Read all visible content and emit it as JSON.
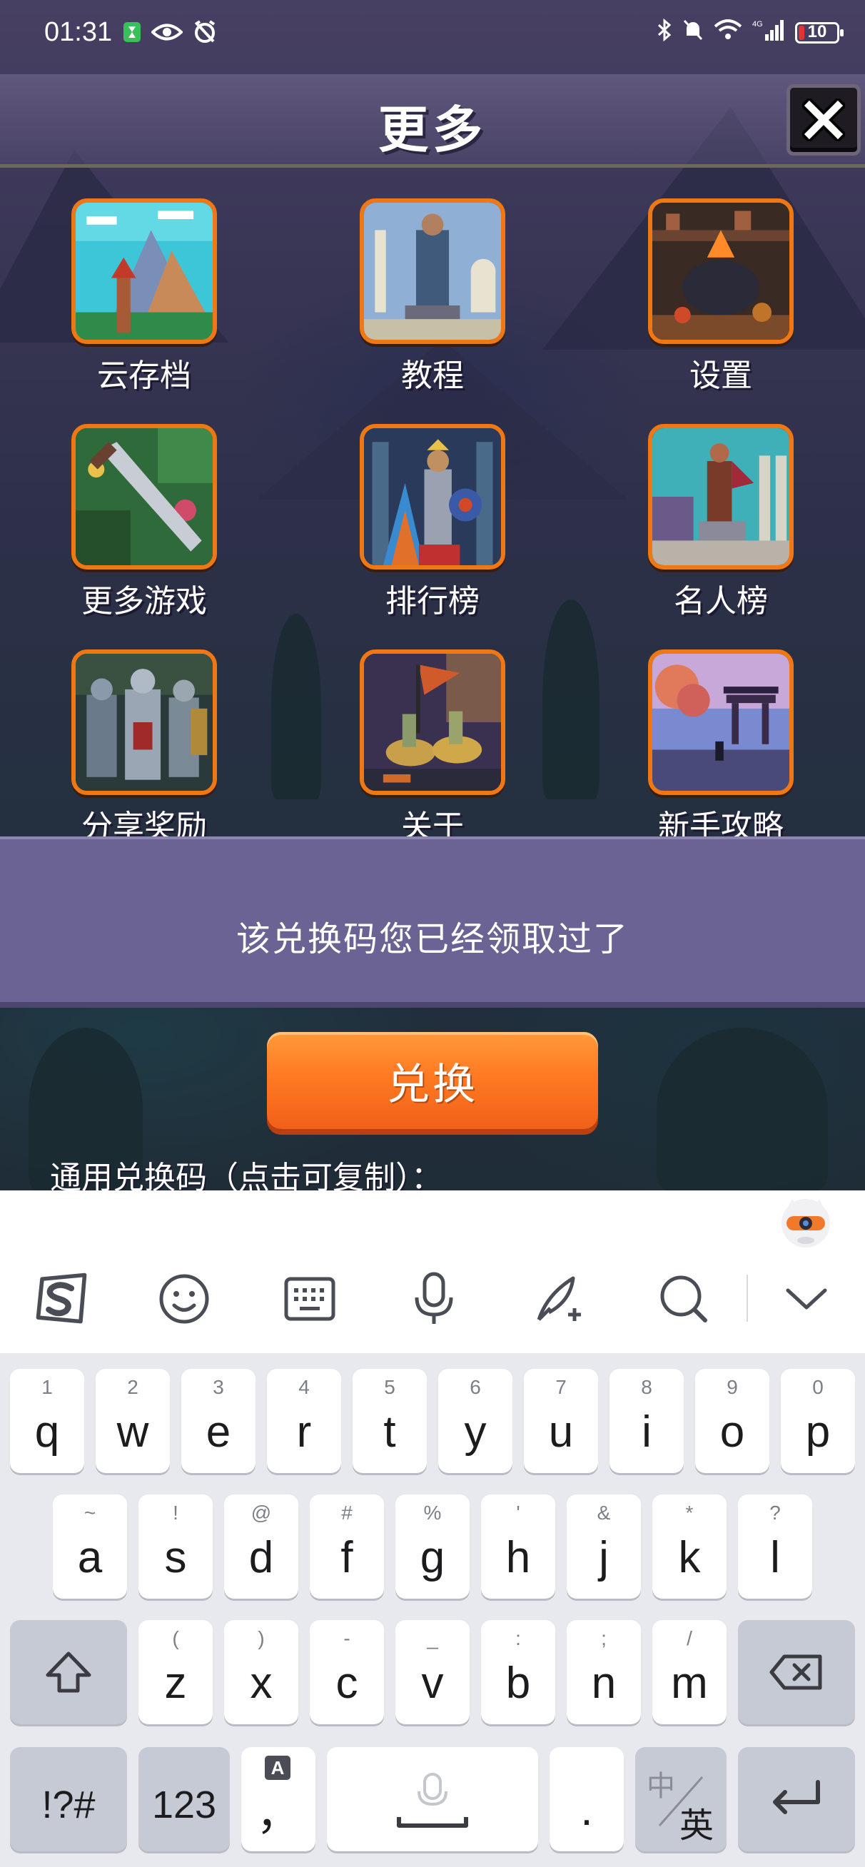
{
  "status_bar": {
    "time": "01:31",
    "battery_level": 10,
    "network": "4G"
  },
  "header": {
    "title": "更多",
    "close_icon": "close-x-icon"
  },
  "menu_items": [
    {
      "label": "云存档",
      "art": "mountain-tower"
    },
    {
      "label": "教程",
      "art": "statue"
    },
    {
      "label": "设置",
      "art": "cauldron"
    },
    {
      "label": "更多游戏",
      "art": "sword"
    },
    {
      "label": "排行榜",
      "art": "king"
    },
    {
      "label": "名人榜",
      "art": "warrior-statue"
    },
    {
      "label": "分享奖励",
      "art": "knights"
    },
    {
      "label": "关于",
      "art": "cavalry"
    },
    {
      "label": "新手攻略",
      "art": "shrine"
    }
  ],
  "message": "该兑换码您已经领取过了",
  "redeem": {
    "button_label": "兑换",
    "hint": "通用兑换码（点击可复制）："
  },
  "keyboard": {
    "toolbar_icons": [
      "sogou-logo-icon",
      "emoji-icon",
      "keyboard-icon",
      "microphone-icon",
      "handwriting-icon",
      "search-icon",
      "collapse-chevron-icon"
    ],
    "row1": [
      {
        "main": "q",
        "sub": "1"
      },
      {
        "main": "w",
        "sub": "2"
      },
      {
        "main": "e",
        "sub": "3"
      },
      {
        "main": "r",
        "sub": "4"
      },
      {
        "main": "t",
        "sub": "5"
      },
      {
        "main": "y",
        "sub": "6"
      },
      {
        "main": "u",
        "sub": "7"
      },
      {
        "main": "i",
        "sub": "8"
      },
      {
        "main": "o",
        "sub": "9"
      },
      {
        "main": "p",
        "sub": "0"
      }
    ],
    "row2": [
      {
        "main": "a",
        "sub": "~"
      },
      {
        "main": "s",
        "sub": "!"
      },
      {
        "main": "d",
        "sub": "@"
      },
      {
        "main": "f",
        "sub": "#"
      },
      {
        "main": "g",
        "sub": "%"
      },
      {
        "main": "h",
        "sub": "'"
      },
      {
        "main": "j",
        "sub": "&"
      },
      {
        "main": "k",
        "sub": "*"
      },
      {
        "main": "l",
        "sub": "?"
      }
    ],
    "row3": [
      {
        "main": "z",
        "sub": "("
      },
      {
        "main": "x",
        "sub": ")"
      },
      {
        "main": "c",
        "sub": "-"
      },
      {
        "main": "v",
        "sub": "_"
      },
      {
        "main": "b",
        "sub": ":"
      },
      {
        "main": "n",
        "sub": ";"
      },
      {
        "main": "m",
        "sub": "/"
      }
    ],
    "symbols_label": "!?#",
    "numbers_label": "123",
    "comma_label": "，",
    "comma_sub": "A",
    "period_label": ".",
    "lang_top": "中",
    "lang_bottom": "英"
  }
}
